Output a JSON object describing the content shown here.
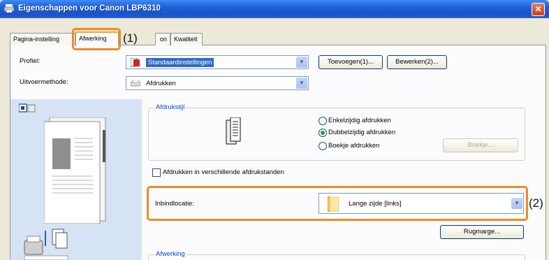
{
  "window": {
    "title": "Eigenschappen voor Canon LBP6310",
    "close_glyph": "✕"
  },
  "tabs": [
    {
      "label": "Pagina-instelling"
    },
    {
      "label": "Afwerking"
    },
    {
      "label": "on"
    },
    {
      "label": "Kwaliteit"
    }
  ],
  "profile": {
    "label": "Profiel:",
    "value": "Standaardinstellingen",
    "add_button": "Toevoegen(1)...",
    "edit_button": "Bewerken(2)..."
  },
  "output": {
    "label": "Uitvoermethode:",
    "value": "Afdrukken"
  },
  "print_style": {
    "title": "Afdrukstijl",
    "options": [
      {
        "label": "Enkelzijdig afdrukken",
        "checked": false
      },
      {
        "label": "Dubbelzijdig afdrukken",
        "checked": true
      },
      {
        "label": "Boekje afdrukken",
        "checked": false
      }
    ],
    "booklet_button": "Boekje..."
  },
  "mixed_print_checkbox": "Afdrukken in verschillende afdrukstanden",
  "binding": {
    "label": "Inbindlocatie:",
    "value": "Lange zijde [links]"
  },
  "gutter_button": "Rugmarge...",
  "finishing_group": "Afwerking",
  "callouts": [
    {
      "label": "(1)"
    },
    {
      "label": "(2)"
    }
  ],
  "colors": {
    "callout": "#f08a24",
    "titlebar": "#1f5fd6",
    "preview_bg": "#d6e3f5"
  }
}
